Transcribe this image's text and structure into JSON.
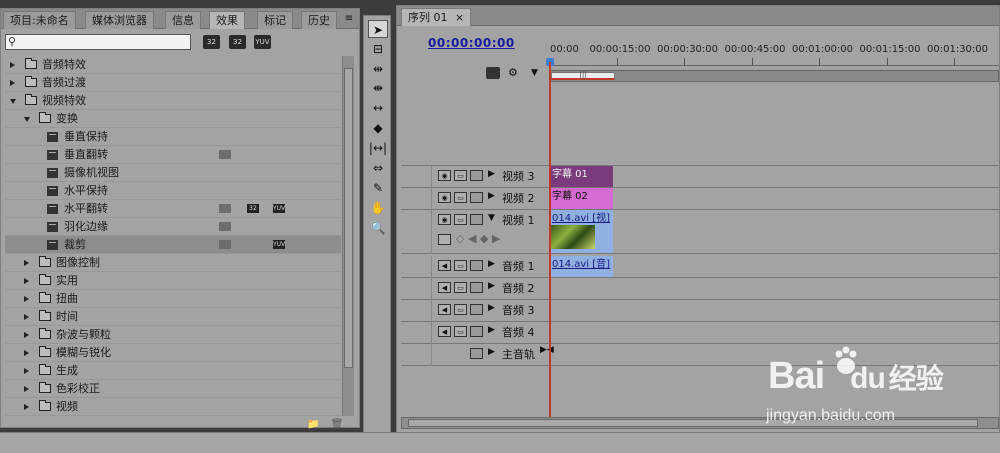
{
  "left_panel": {
    "tabs": [
      "项目:未命名",
      "媒体浏览器",
      "信息",
      "效果",
      "标记",
      "历史"
    ],
    "active_tab": "效果",
    "search_placeholder": "",
    "toolbar_badges": [
      "32",
      "32",
      "YUV"
    ],
    "tree": [
      {
        "label": "音频特效",
        "depth": 0,
        "type": "folder",
        "expanded": false
      },
      {
        "label": "音频过渡",
        "depth": 0,
        "type": "folder",
        "expanded": false
      },
      {
        "label": "视频特效",
        "depth": 0,
        "type": "folder",
        "expanded": true
      },
      {
        "label": "变换",
        "depth": 1,
        "type": "folder",
        "expanded": true
      },
      {
        "label": "垂直保持",
        "depth": 2,
        "type": "effect"
      },
      {
        "label": "垂直翻转",
        "depth": 2,
        "type": "effect"
      },
      {
        "label": "摄像机视图",
        "depth": 2,
        "type": "effect"
      },
      {
        "label": "水平保持",
        "depth": 2,
        "type": "effect"
      },
      {
        "label": "水平翻转",
        "depth": 2,
        "type": "effect"
      },
      {
        "label": "羽化边缘",
        "depth": 2,
        "type": "effect"
      },
      {
        "label": "裁剪",
        "depth": 2,
        "type": "effect",
        "selected": true
      },
      {
        "label": "图像控制",
        "depth": 1,
        "type": "folder",
        "expanded": false
      },
      {
        "label": "实用",
        "depth": 1,
        "type": "folder",
        "expanded": false
      },
      {
        "label": "扭曲",
        "depth": 1,
        "type": "folder",
        "expanded": false
      },
      {
        "label": "时间",
        "depth": 1,
        "type": "folder",
        "expanded": false
      },
      {
        "label": "杂波与颗粒",
        "depth": 1,
        "type": "folder",
        "expanded": false
      },
      {
        "label": "模糊与锐化",
        "depth": 1,
        "type": "folder",
        "expanded": false
      },
      {
        "label": "生成",
        "depth": 1,
        "type": "folder",
        "expanded": false
      },
      {
        "label": "色彩校正",
        "depth": 1,
        "type": "folder",
        "expanded": false
      },
      {
        "label": "视频",
        "depth": 1,
        "type": "folder",
        "expanded": false
      }
    ]
  },
  "sequence": {
    "tab_label": "序列 01",
    "timecode": "00:00:00:00",
    "ruler_ticks": [
      "00:00",
      "00:00:15:00",
      "00:00:30:00",
      "00:00:45:00",
      "00:01:00:00",
      "00:01:15:00",
      "00:01:30:00"
    ],
    "video_tracks": [
      {
        "name": "视频 3",
        "clip": "字幕 01",
        "clip_color": "#7a3a7e"
      },
      {
        "name": "视频 2",
        "clip": "字幕 02",
        "clip_color": "#d46bd0"
      },
      {
        "name": "视频 1",
        "clip": "014.avi [视]",
        "clip_color": "#8fb0e0"
      }
    ],
    "audio_tracks": [
      {
        "name": "音频 1",
        "clip": "014.avi [音]",
        "clip_color": "#8fb0e0"
      },
      {
        "name": "音频 2",
        "clip": ""
      },
      {
        "name": "音频 3",
        "clip": ""
      },
      {
        "name": "音频 4",
        "clip": ""
      }
    ],
    "master_track": "主音轨"
  },
  "watermark": {
    "brand": "Bai",
    "brand2": "du",
    "brand_cn": "经验",
    "url": "jingyan.baidu.com"
  }
}
